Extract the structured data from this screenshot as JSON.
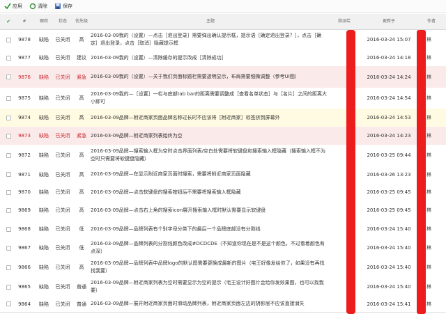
{
  "toolbar": {
    "apply_label": "应用",
    "clear_label": "清除",
    "save_label": "保存"
  },
  "columns": {
    "check": "✔",
    "id": "#",
    "type": "跟踪",
    "status": "状态",
    "priority": "优先级",
    "title": "主题",
    "assignee": "指派给",
    "updated": "更新于",
    "author": "作者"
  },
  "author_visible_char": "林",
  "rows": [
    {
      "id": "9878",
      "type": "缺陷",
      "status": "已关闭",
      "priority": "高",
      "title": "2016-03-09我的（设置）—点击［退出登录］需要弹出确认提示框，提示语［确定退出登录？］，点击［确定］退出登录，点击［取消］隐藏提示框",
      "updated": "2016-03-24 15:07",
      "author": "林",
      "color": "white",
      "text": "normal"
    },
    {
      "id": "9877",
      "type": "缺陷",
      "status": "已关闭",
      "priority": "建议",
      "title": "2016-03-09我的（设置）—清除缓存的提示改成［清除成功］",
      "updated": "2016-03-24 14:18",
      "author": "林",
      "color": "white",
      "text": "normal"
    },
    {
      "id": "9876",
      "type": "缺陷",
      "status": "已关闭",
      "priority": "紧急",
      "title": "2016-03-09我的（设置）—关于我们页面标题栏需要透明显示，布局需要细微调整（参考UI图）",
      "updated": "2016-03-24 14:24",
      "author": "林",
      "color": "pink",
      "text": "red"
    },
    {
      "id": "9875",
      "type": "缺陷",
      "status": "已关闭",
      "priority": "高",
      "title": "2016-03-09我的—［设置］一栏与底部tab bar的距离需要调整成［查看名单状态］与［名片］之间的距离大小即可",
      "updated": "2016-03-24 14:54",
      "author": "林",
      "color": "white",
      "text": "normal"
    },
    {
      "id": "9874",
      "type": "缺陷",
      "status": "已关闭",
      "priority": "高",
      "title": "2016-03-09品牌—附近商家页面品牌名称过长时不应该将［附近商家］标签挤到屏幕外",
      "updated": "2016-03-24 14:53",
      "author": "林",
      "color": "yellow",
      "text": "normal"
    },
    {
      "id": "9873",
      "type": "缺陷",
      "status": "已关闭",
      "priority": "紧急",
      "title": "2016-03-09品牌—附近商家列表始终为空",
      "updated": "2016-03-24 14:23",
      "author": "林",
      "color": "pink",
      "text": "red"
    },
    {
      "id": "9872",
      "type": "缺陷",
      "status": "已关闭",
      "priority": "高",
      "title": "2016-03-09品牌—搜索输入框为空时点击界面列表/空白处需要将软键盘和搜索输入框隐藏（搜索输入框不为空时只需要将软键盘隐藏）",
      "updated": "2016-03-25 09:44",
      "author": "林",
      "color": "white",
      "text": "normal"
    },
    {
      "id": "9871",
      "type": "缺陷",
      "status": "已关闭",
      "priority": "高",
      "title": "2016-03-09品牌—在显示附近商家页面时搜索，需要将附近商家页面隐藏",
      "updated": "2016-03-26 13:23",
      "author": "林",
      "color": "white",
      "text": "normal"
    },
    {
      "id": "9870",
      "type": "缺陷",
      "status": "已关闭",
      "priority": "高",
      "title": "2016-03-09品牌—点击软键盘的搜索按钮后不需要将搜索输入框隐藏",
      "updated": "2016-03-25 09:45",
      "author": "林",
      "color": "white",
      "text": "normal"
    },
    {
      "id": "9869",
      "type": "缺陷",
      "status": "已关闭",
      "priority": "高",
      "title": "2016-03-09品牌—点击右上角的搜索icon展开搜索输入框时默认需要显示软键盘",
      "updated": "2016-03-25 09:45",
      "author": "林",
      "color": "white",
      "text": "normal"
    },
    {
      "id": "9868",
      "type": "缺陷",
      "status": "已关闭",
      "priority": "低",
      "title": "2016-03-09品牌—品牌列表有个别字母分类下的最后一个品牌底部没有分割线",
      "updated": "2016-03-24 15:40",
      "author": "林",
      "color": "white",
      "text": "normal"
    },
    {
      "id": "9867",
      "type": "缺陷",
      "status": "已关闭",
      "priority": "低",
      "title": "2016-03-09品牌—品牌列表的分割线颜色改成#DCDCDE（不知道你现在是不是这个颜色，不过看着颜色有点深）",
      "updated": "2016-03-24 15:40",
      "author": "林",
      "color": "white",
      "text": "normal"
    },
    {
      "id": "9866",
      "type": "缺陷",
      "status": "已关闭",
      "priority": "高",
      "title": "2016-03-09品牌—品牌列表中品牌logo的默认图需要更换成最新的图片（宅王好像发给你了，如果没有再找找我要）",
      "updated": "2016-03-24 15:40",
      "author": "林",
      "color": "white",
      "text": "normal"
    },
    {
      "id": "9865",
      "type": "缺陷",
      "status": "已关闭",
      "priority": "普通",
      "title": "2016-03-09品牌—附近商家列表为空时需要显示为空的提示（宅王设计好图片会给你发效果图，也可以找我要）",
      "updated": "2016-03-24 15:40",
      "author": "林",
      "color": "white",
      "text": "normal"
    },
    {
      "id": "9864",
      "type": "缺陷",
      "status": "已关闭",
      "priority": "普通",
      "title": "2016-03-09品牌—展开附近商家页面时滑动品牌列表，附近商家页面左边的阴影层不应该直接消失",
      "updated": "2016-03-24 15:41",
      "author": "林",
      "color": "white",
      "text": "normal"
    }
  ]
}
